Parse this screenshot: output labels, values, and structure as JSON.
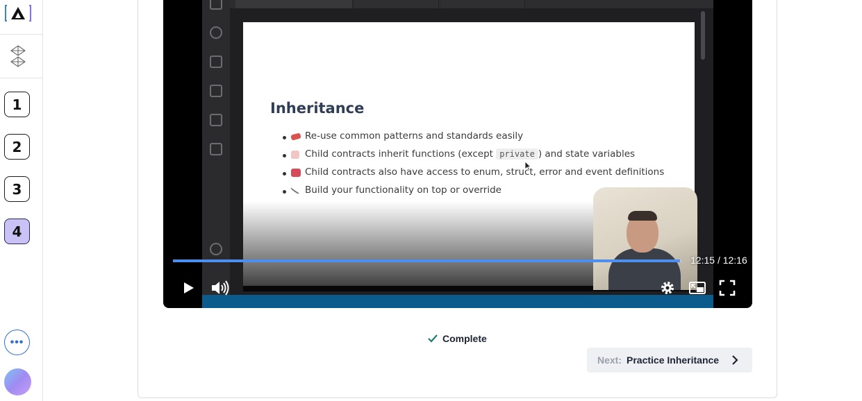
{
  "rail": {
    "steps": [
      "1",
      "2",
      "3",
      "4"
    ],
    "active_step": "4",
    "more_label": "•••"
  },
  "video": {
    "slide": {
      "title": "Inheritance",
      "bullets": [
        {
          "text": "Re-use common patterns and standards easily"
        },
        {
          "pre": "Child contracts inherit functions (except ",
          "code": "private",
          "post": ") and state variables"
        },
        {
          "text": "Child contracts also have access to enum, struct, error and event definitions"
        },
        {
          "text": "Build your functionality on top or override"
        }
      ]
    },
    "time_current": "12:15",
    "time_separator": "/",
    "time_total": "12:16",
    "progress": 0.9986,
    "colors": {
      "progress": "#4d8ff0"
    }
  },
  "complete": {
    "label": "Complete",
    "icon": "check-icon",
    "color": "#1a7f6e"
  },
  "next": {
    "prefix": "Next:",
    "title": "Practice Inheritance",
    "icon": "chevron-right-icon"
  }
}
